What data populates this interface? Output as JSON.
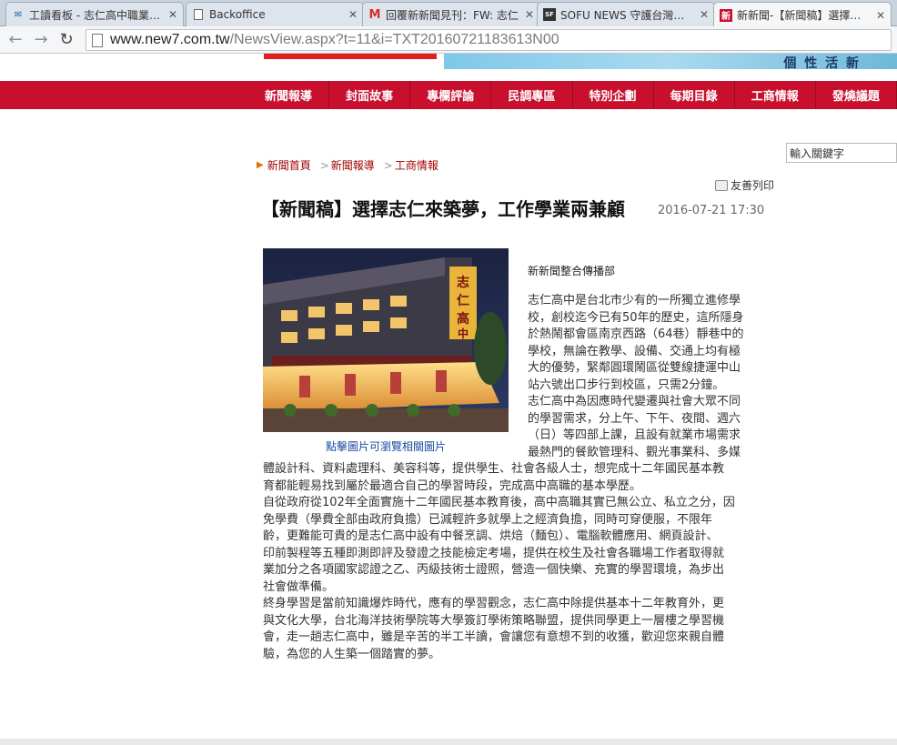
{
  "browser": {
    "tabs": [
      {
        "title": "工讀看板 - 志仁高中職業進修學校",
        "favicon": "mail"
      },
      {
        "title": "Backoffice",
        "favicon": "page"
      },
      {
        "title": "回覆新新聞見刊：FW: 志仁",
        "favicon": "gmail"
      },
      {
        "title": "SOFU NEWS 守護台灣新聞網",
        "favicon": "sofu"
      },
      {
        "title": "新新聞-【新聞稿】選擇志仁",
        "favicon": "new7"
      }
    ],
    "url_domain": "www.new7.com.tw",
    "url_path": "/NewsView.aspx?t=11&i=TXT20160721183613N00"
  },
  "site": {
    "banner_text": "個 性 活 新",
    "nav": [
      "新聞報導",
      "封面故事",
      "專欄評論",
      "民調專區",
      "特別企劃",
      "每期目錄",
      "工商情報",
      "發燒議題"
    ],
    "search_placeholder": "輸入關鍵字"
  },
  "breadcrumb": [
    "新聞首頁",
    "新聞報導",
    "工商情報"
  ],
  "print_label": "友善列印",
  "article": {
    "title": "【新聞稿】選擇志仁來築夢，工作學業兩兼顧",
    "date": "2016-07-21 17:30",
    "photo_caption": "點擊圖片可瀏覽相關圖片",
    "byline": "新新聞整合傳播部",
    "side_lines": [
      "志仁高中是台北市少有的一所獨立進修學",
      "校，創校迄今已有50年的歷史，這所隱身",
      "於熱鬧都會區南京西路（64巷）靜巷中的",
      "學校，無論在教學、設備、交通上均有極",
      "大的優勢，緊鄰圓環鬧區從雙線捷運中山",
      "站六號出口步行到校區，只需2分鐘。",
      "志仁高中為因應時代變遷與社會大眾不同",
      "的學習需求，分上午、下午、夜間、週六",
      "（日）等四部上課，且設有就業市場需求",
      "最熱門的餐飲管理科、觀光事業科、多媒"
    ],
    "full_lines": [
      "體設計科、資料處理科、美容科等，提供學生、社會各級人士，想完成十二年國民基本教",
      "育都能輕易找到屬於最適合自己的學習時段，完成高中高職的基本學歷。",
      "自從政府從102年全面實施十二年國民基本教育後，高中高職其實已無公立、私立之分，因",
      "免學費（學費全部由政府負擔）已減輕許多就學上之經濟負擔，同時可穿便服，不限年",
      "齡，更難能可貴的是志仁高中設有中餐烹調、烘焙（麵包）、電腦軟體應用、網頁設計、",
      "印前製程等五種即測即評及發證之技能檢定考場，提供在校生及社會各職場工作者取得就",
      "業加分之各項國家認證之乙、丙級技術士證照，營造一個快樂、充實的學習環境，為步出",
      "社會做準備。",
      "終身學習是當前知識爆炸時代，應有的學習觀念，志仁高中除提供基本十二年教育外，更",
      "與文化大學，台北海洋技術學院等大學簽訂學術策略聯盟，提供同學更上一層樓之學習機",
      "會，走一趟志仁高中，雖是辛苦的半工半讀，會讓您有意想不到的收獲，歡迎您來親自體",
      "驗，為您的人生築一個踏實的夢。"
    ]
  }
}
